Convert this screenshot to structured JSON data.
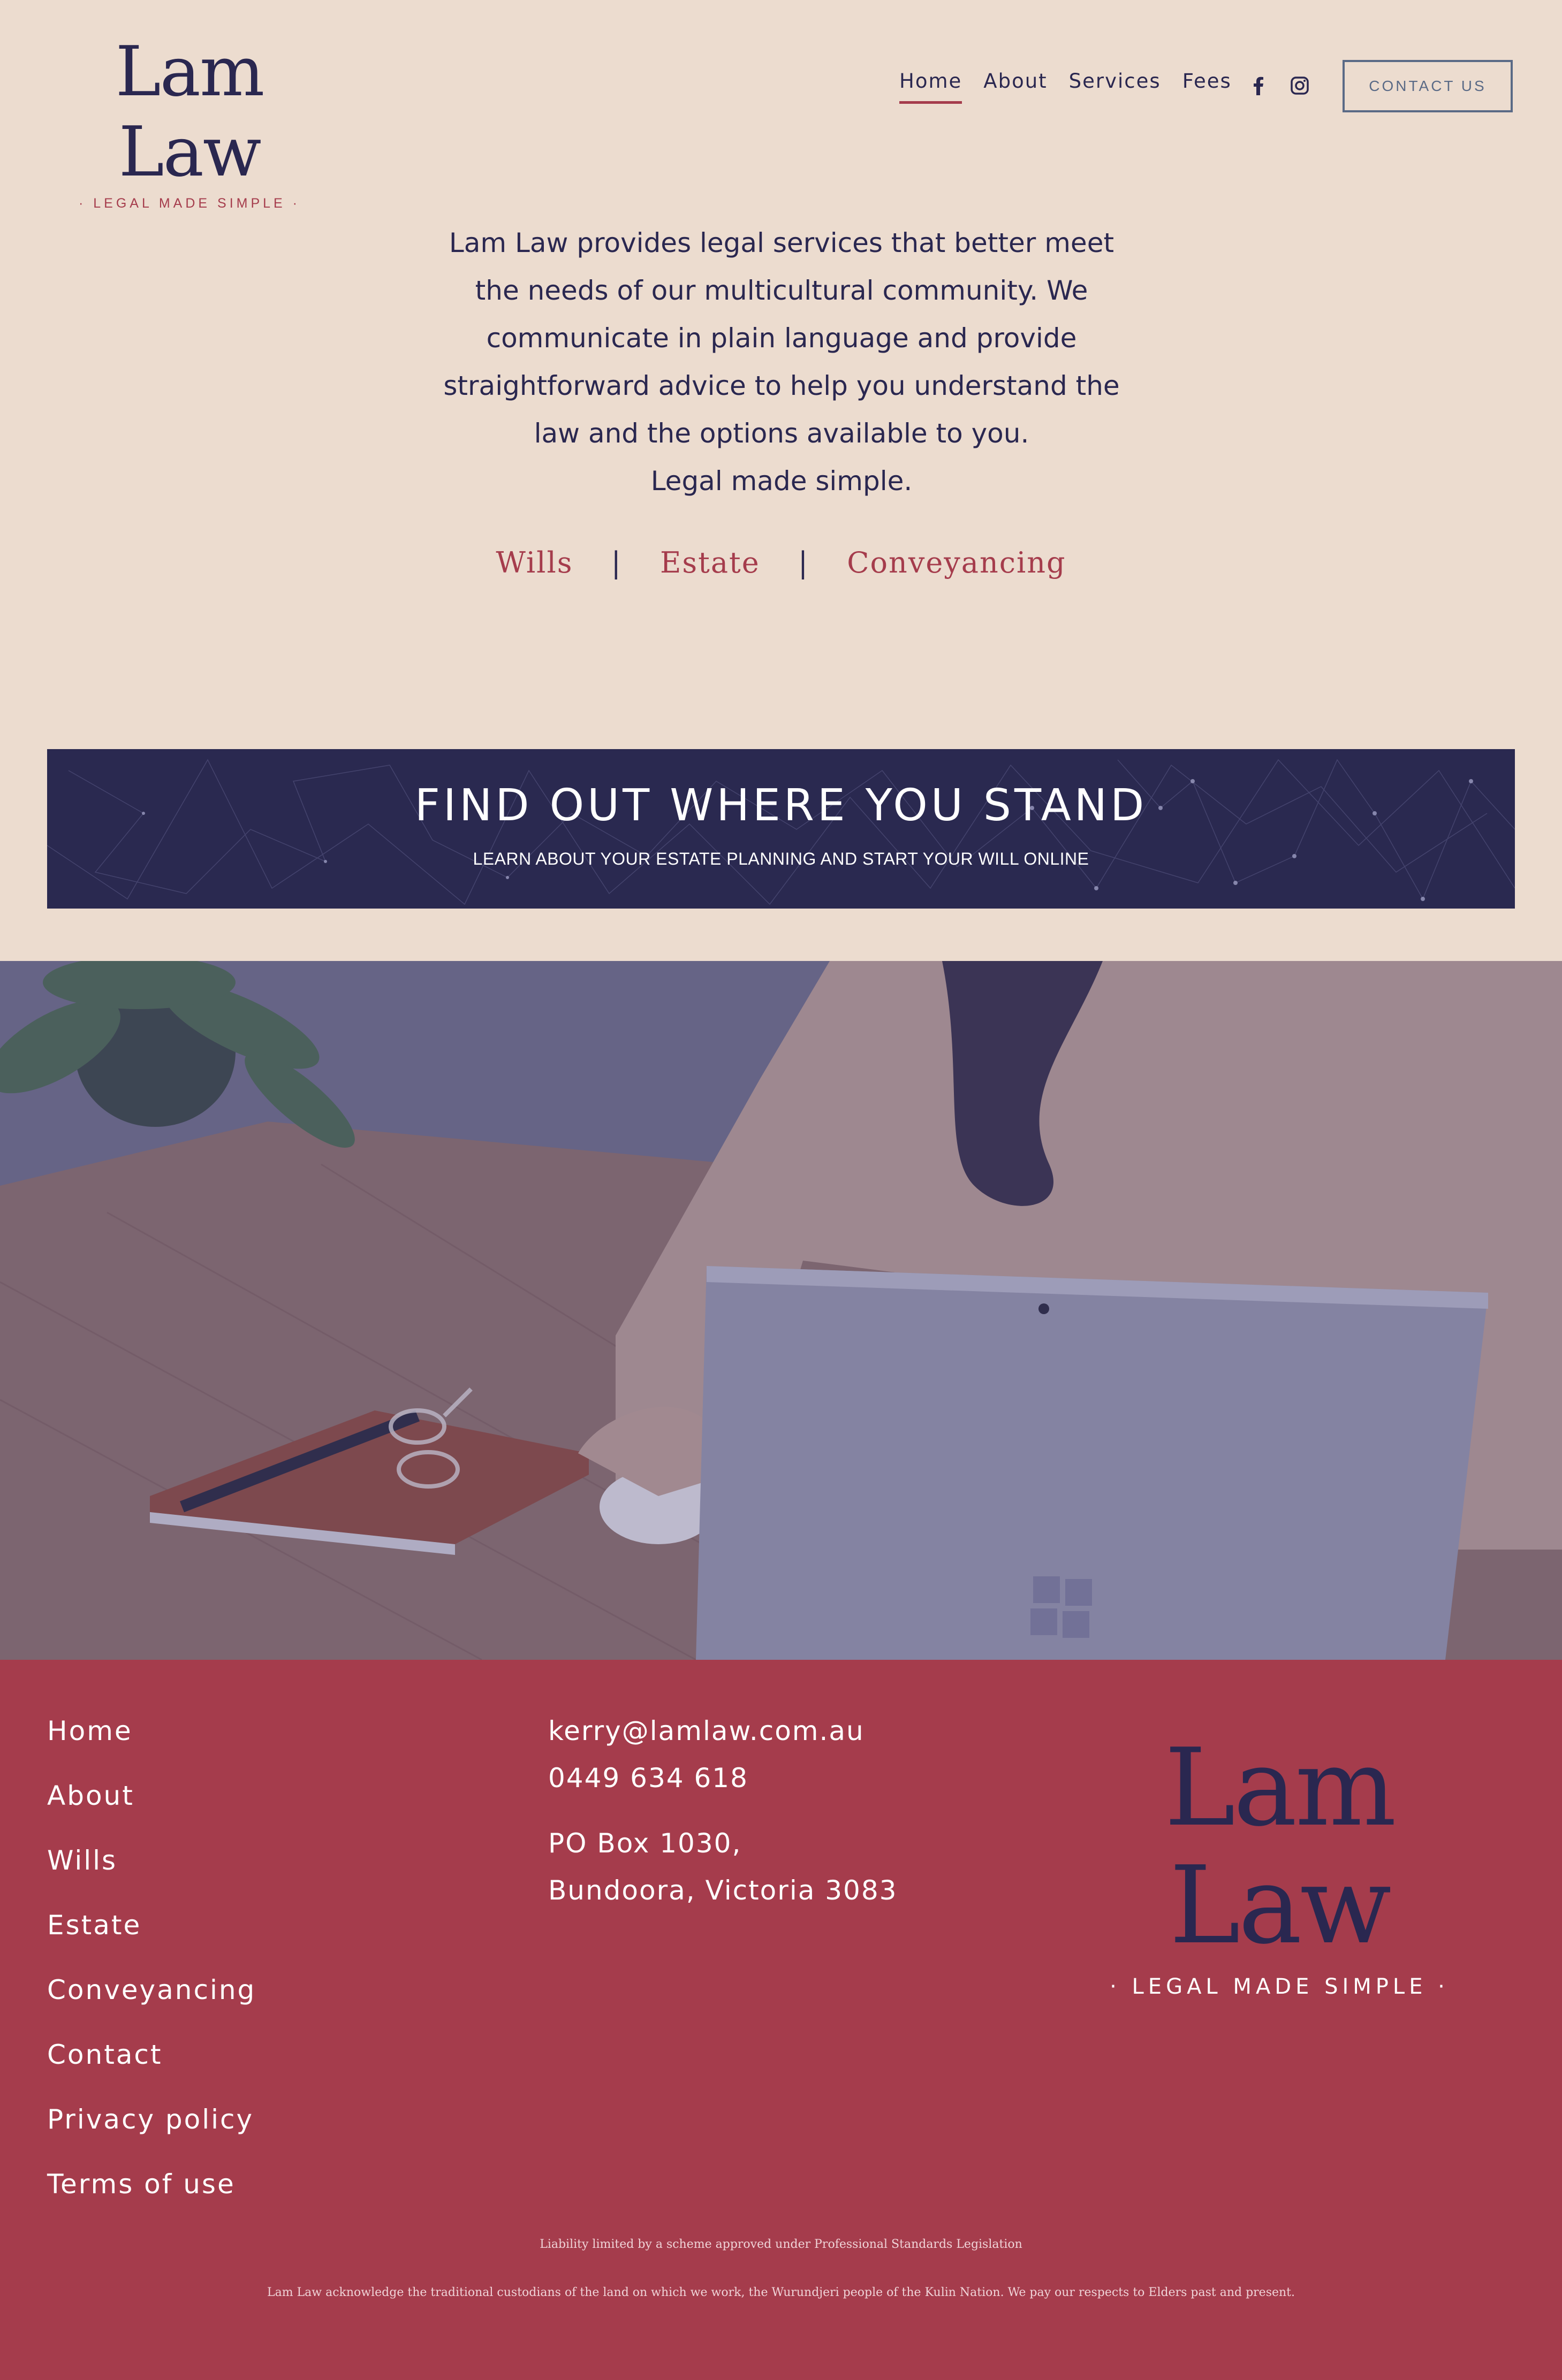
{
  "header": {
    "logo_title": "Lam Law",
    "logo_tagline": "· LEGAL MADE SIMPLE ·",
    "nav": [
      {
        "label": "Home",
        "active": true
      },
      {
        "label": "About",
        "active": false
      },
      {
        "label": "Services",
        "active": false
      },
      {
        "label": "Fees",
        "active": false
      }
    ],
    "social_icons": [
      "facebook-icon",
      "instagram-icon"
    ],
    "contact_button": "CONTACT US"
  },
  "intro": {
    "lines": [
      "Lam Law provides legal services that better meet",
      "the needs of our multicultural community. We",
      "communicate in plain language and provide",
      "straightforward advice to help you understand the",
      "law and the options available to you.",
      "Legal made simple."
    ],
    "services": [
      "Wills",
      "Estate",
      "Conveyancing"
    ],
    "separator": "|"
  },
  "banner": {
    "title": "FIND OUT WHERE YOU STAND",
    "subtitle": "LEARN ABOUT YOUR ESTATE PLANNING AND START YOUR WILL ONLINE"
  },
  "footer": {
    "links": [
      "Home",
      "About",
      "Wills",
      "Estate",
      "Conveyancing",
      "Contact",
      "Privacy policy",
      "Terms of use"
    ],
    "email": "kerry@lamlaw.com.au",
    "phone": "0449 634 618",
    "address_line1": "PO Box 1030,",
    "address_line2": "Bundoora, Victoria 3083",
    "logo_title": "Lam Law",
    "logo_tagline": "· LEGAL MADE SIMPLE ·",
    "liability": "Liability limited by a scheme approved under Professional Standards Legislation",
    "acknowledgement": "Lam Law acknowledge the traditional custodians of the land on which we work, the Wurundjeri people of the Kulin Nation. We pay our respects to Elders past and present."
  },
  "colors": {
    "background": "#ecdccf",
    "navy": "#2a2750",
    "accent_red": "#a53c4c",
    "banner": "#2a2950",
    "footer": "#a53c4c"
  }
}
